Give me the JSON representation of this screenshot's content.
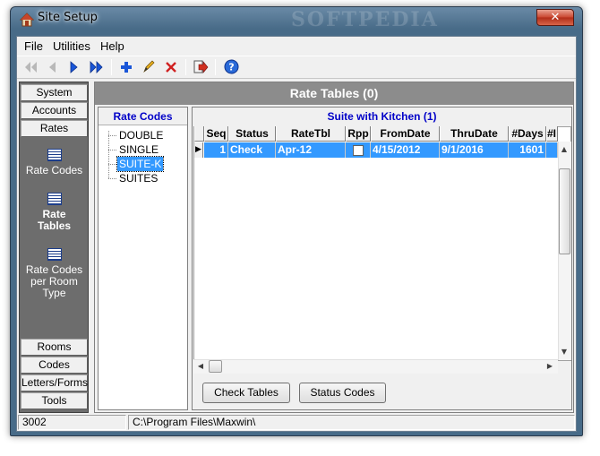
{
  "window": {
    "title": "Site Setup",
    "watermark": "SOFTPEDIA",
    "close_label": "✕"
  },
  "menu": {
    "items": [
      "File",
      "Utilities",
      "Help"
    ]
  },
  "toolbar": {
    "buttons": [
      "first-icon",
      "prev-icon",
      "next-icon",
      "last-icon",
      "add-icon",
      "edit-icon",
      "delete-icon",
      "exit-icon",
      "help-icon"
    ]
  },
  "nav": {
    "top_buttons": [
      "System",
      "Accounts",
      "Rates"
    ],
    "sub_items": [
      "Rate Codes",
      "Rate\nTables",
      "Rate Codes\nper Room\nType"
    ],
    "active_sub": "Rate Tables",
    "bottom_buttons": [
      "Rooms",
      "Codes",
      "Letters/Forms",
      "Tools"
    ]
  },
  "panel": {
    "title": "Rate Tables (0)"
  },
  "rate_codes": {
    "header": "Rate Codes",
    "items": [
      "DOUBLE",
      "SINGLE",
      "SUITE-K",
      "SUITES"
    ],
    "selected": "SUITE-K"
  },
  "grid": {
    "title": "Suite with Kitchen (1)",
    "columns": [
      "Seq",
      "Status",
      "RateTbl",
      "Rpp",
      "FromDate",
      "ThruDate",
      "#Days",
      "#I"
    ],
    "rows": [
      {
        "seq": "1",
        "status": "Check",
        "ratetbl": "Apr-12",
        "rpp": false,
        "fromdate": "4/15/2012",
        "thrudate": "9/1/2016",
        "days": "1601",
        "extra": ""
      }
    ]
  },
  "buttons": {
    "check_tables": "Check Tables",
    "status_codes": "Status Codes"
  },
  "statusbar": {
    "left": "3002",
    "path": "C:\\Program Files\\Maxwin\\"
  },
  "colors": {
    "selection": "#3399ff",
    "header_blue": "#0000c8",
    "nav_bg": "#6d6d6d",
    "panel_title_bg": "#8c8c8c"
  }
}
